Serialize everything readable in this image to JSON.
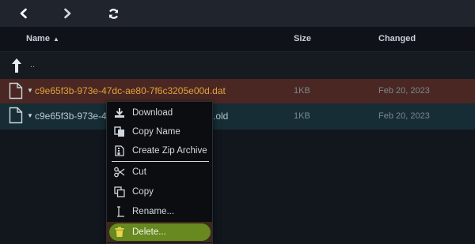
{
  "toolbar": {
    "back_icon": "chevron-left-icon",
    "forward_icon": "chevron-right-icon",
    "refresh_icon": "refresh-icon"
  },
  "columns": {
    "name": "Name",
    "size": "Size",
    "changed": "Changed"
  },
  "parent_row": {
    "label": ".."
  },
  "files": [
    {
      "name": "c9e65f3b-973e-47dc-ae80-7f6c3205e00d.dat",
      "size": "1KB",
      "changed": "Feb 20, 2023"
    },
    {
      "name_prefix": "c9e65f3b-973e-47",
      "name_suffix": ".old",
      "size": "1KB",
      "changed": "Feb 20, 2023"
    }
  ],
  "context_menu": {
    "items": [
      {
        "label": "Download",
        "icon": "download-icon"
      },
      {
        "label": "Copy Name",
        "icon": "copy-name-icon"
      },
      {
        "label": "Create Zip Archive",
        "icon": "zip-archive-icon"
      },
      {
        "label": "Cut",
        "icon": "scissors-icon"
      },
      {
        "label": "Copy",
        "icon": "copy-icon"
      },
      {
        "label": "Rename...",
        "icon": "rename-cursor-icon"
      },
      {
        "label": "Delete...",
        "icon": "trash-icon"
      }
    ]
  },
  "colors": {
    "selected_row": "#4a2722",
    "selected_text": "#e2a23a",
    "highlight_delete": "#6f9a22"
  }
}
